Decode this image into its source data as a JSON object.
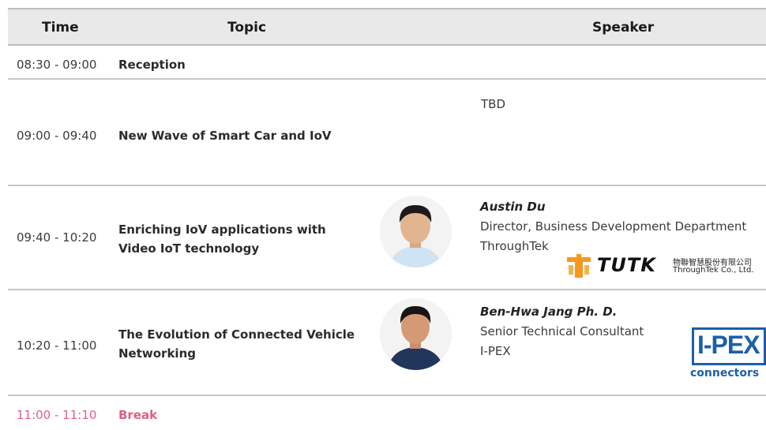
{
  "header": {
    "time": "Time",
    "topic": "Topic",
    "speaker": "Speaker"
  },
  "rows": [
    {
      "time": "08:30 - 09:00",
      "topic": "Reception"
    },
    {
      "time": "09:00 - 09:40",
      "topic": "New Wave of Smart Car and IoV",
      "speaker_text": "TBD"
    },
    {
      "time": "09:40 - 10:20",
      "topic_lines": [
        "Enriching IoV applications with",
        "Video IoT technology"
      ],
      "speaker": {
        "name": "Austin Du",
        "title": "Director, Business Development Department",
        "company": "ThroughTek",
        "logo_text": "TUTK",
        "logo_sub_cn": "物聯智慧股份有限公司",
        "logo_sub_en": "ThroughTek Co., Ltd."
      }
    },
    {
      "time": "10:20 - 11:00",
      "topic_lines": [
        "The Evolution of Connected Vehicle",
        "Networking"
      ],
      "speaker": {
        "name": "Ben-Hwa Jang Ph. D.",
        "title": "Senior Technical Consultant",
        "company": "I-PEX",
        "logo_text": "I-PEX",
        "logo_sub": "connectors"
      }
    },
    {
      "time": "11:00 - 11:10",
      "topic": "Break"
    }
  ],
  "colors": {
    "header_bg": "#e9e9e9",
    "divider": "#c6c6c6",
    "break": "#e2607f",
    "ipex_blue": "#1c5fa8",
    "tutk_orange": "#f39a1e"
  }
}
